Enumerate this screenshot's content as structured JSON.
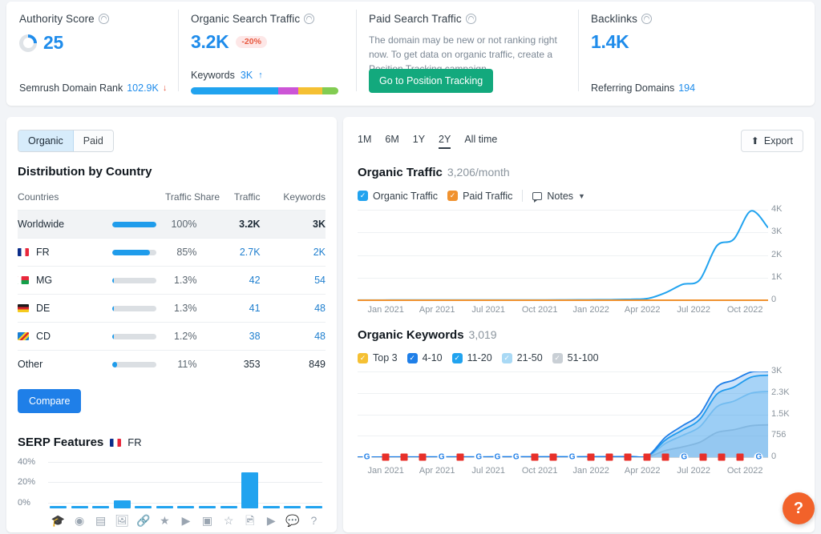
{
  "header": {
    "authority": {
      "label": "Authority Score",
      "value": "25",
      "footnote_label": "Semrush Domain Rank",
      "footnote_value": "102.9K",
      "footnote_trend": "down",
      "donut_percent": 25
    },
    "organic_search": {
      "label": "Organic Search Traffic",
      "value": "3.2K",
      "change": "-20%",
      "change_color": "#e8593f",
      "keywords_label": "Keywords",
      "keywords_value": "3K",
      "keywords_trend": "up",
      "bar_segments": [
        {
          "name": "top3",
          "color": "#21a3ef",
          "pct": 59
        },
        {
          "name": "4-10",
          "color": "#cc55d6",
          "pct": 14
        },
        {
          "name": "11-20",
          "color": "#f5c033",
          "pct": 16
        },
        {
          "name": "21-50",
          "color": "#82cc52",
          "pct": 11
        }
      ]
    },
    "paid_search": {
      "label": "Paid Search Traffic",
      "description": "The domain may be new or not ranking right now. To get data on organic traffic, create a Position Tracking campaign.",
      "button": "Go to Position Tracking",
      "button_color": "#13a97d"
    },
    "backlinks": {
      "label": "Backlinks",
      "value": "1.4K",
      "footnote_label": "Referring Domains",
      "footnote_value": "194"
    }
  },
  "left": {
    "toggle": {
      "organic": "Organic",
      "paid": "Paid",
      "selected": "Organic"
    },
    "distribution_title": "Distribution by Country",
    "columns": [
      "Countries",
      "Traffic Share",
      "Traffic",
      "Keywords"
    ],
    "rows": [
      {
        "country": "Worldwide",
        "flag": null,
        "share_pct": 100,
        "share": "100%",
        "traffic": "3.2K",
        "keywords": "3K",
        "highlight": true
      },
      {
        "country": "FR",
        "flag": "fr",
        "share_pct": 85,
        "share": "85%",
        "traffic": "2.7K",
        "keywords": "2K",
        "highlight": false
      },
      {
        "country": "MG",
        "flag": "mg",
        "share_pct": 3,
        "share": "1.3%",
        "traffic": "42",
        "keywords": "54",
        "highlight": false
      },
      {
        "country": "DE",
        "flag": "de",
        "share_pct": 3,
        "share": "1.3%",
        "traffic": "41",
        "keywords": "48",
        "highlight": false
      },
      {
        "country": "CD",
        "flag": "cd",
        "share_pct": 3,
        "share": "1.2%",
        "traffic": "38",
        "keywords": "48",
        "highlight": false
      },
      {
        "country": "Other",
        "flag": null,
        "share_pct": 11,
        "share": "11%",
        "traffic": "353",
        "keywords": "849",
        "highlight": false
      }
    ],
    "compare_button": "Compare",
    "serp": {
      "title": "SERP Features",
      "country": "FR",
      "country_flag": "fr"
    }
  },
  "right": {
    "ranges": [
      "1M",
      "6M",
      "1Y",
      "2Y",
      "All time"
    ],
    "range_selected": "2Y",
    "export": "Export",
    "traffic": {
      "title": "Organic Traffic",
      "value": "3,206/month",
      "legend": [
        {
          "label": "Organic Traffic",
          "color": "#21a3ef",
          "checked": true
        },
        {
          "label": "Paid Traffic",
          "color": "#f0922f",
          "checked": true
        }
      ],
      "notes": "Notes"
    },
    "keywords": {
      "title": "Organic Keywords",
      "value": "3,019",
      "legend": [
        {
          "label": "Top 3",
          "color": "#f5c033",
          "checked": true
        },
        {
          "label": "4-10",
          "color": "#1f7fe8",
          "checked": true
        },
        {
          "label": "11-20",
          "color": "#21a3ef",
          "checked": true
        },
        {
          "label": "21-50",
          "color": "#a9d9f5",
          "checked": true
        },
        {
          "label": "51-100",
          "color": "#c9cfd5",
          "checked": true
        }
      ]
    }
  },
  "help_button": "?",
  "chart_data": [
    {
      "type": "bar",
      "title": "SERP Features",
      "xlabel": "",
      "ylabel": "",
      "ylim": [
        0,
        40
      ],
      "yticks": [
        "0%",
        "20%",
        "40%"
      ],
      "categories": [
        "featured-snippet",
        "local-pack",
        "reviews",
        "image-pack",
        "sitelinks",
        "featured-review",
        "video",
        "video-carousel",
        "top-stories",
        "images",
        "instant-answer",
        "people-also-ask",
        "faq"
      ],
      "values": [
        0.8,
        0.8,
        0.8,
        8,
        2,
        0.8,
        0.8,
        0.8,
        0.8,
        35,
        0.8,
        0.8,
        0.8
      ],
      "grid": true
    },
    {
      "type": "line",
      "title": "Organic Traffic",
      "subtitle": "3,206/month",
      "xlabel": "",
      "ylabel": "",
      "ylim": [
        0,
        4000
      ],
      "yticks": [
        "0",
        "1K",
        "2K",
        "3K",
        "4K"
      ],
      "xtick_labels": [
        "Jan 2021",
        "Apr 2021",
        "Jul 2021",
        "Oct 2021",
        "Jan 2022",
        "Apr 2022",
        "Jul 2022",
        "Oct 2022"
      ],
      "x": [
        "Nov 2020",
        "Dec 2020",
        "Jan 2021",
        "Feb 2021",
        "Mar 2021",
        "Apr 2021",
        "May 2021",
        "Jun 2021",
        "Jul 2021",
        "Aug 2021",
        "Sep 2021",
        "Oct 2021",
        "Nov 2021",
        "Dec 2021",
        "Jan 2022",
        "Feb 2022",
        "Mar 2022",
        "Apr 2022",
        "May 2022",
        "Jun 2022",
        "Jul 2022",
        "Aug 2022",
        "Sep 2022",
        "Oct 2022",
        "Nov 2022"
      ],
      "series": [
        {
          "name": "Organic Traffic",
          "color": "#21a3ef",
          "values": [
            5,
            5,
            6,
            6,
            7,
            7,
            8,
            8,
            9,
            10,
            10,
            12,
            14,
            16,
            20,
            26,
            40,
            80,
            330,
            700,
            900,
            2400,
            2700,
            3950,
            3206
          ]
        },
        {
          "name": "Paid Traffic",
          "color": "#f0922f",
          "values": [
            0,
            0,
            0,
            0,
            0,
            0,
            0,
            0,
            0,
            0,
            0,
            0,
            0,
            0,
            0,
            0,
            0,
            0,
            0,
            0,
            0,
            0,
            0,
            0,
            0
          ]
        }
      ],
      "grid": true,
      "legend_position": "top"
    },
    {
      "type": "area",
      "title": "Organic Keywords",
      "subtitle": "3,019",
      "xlabel": "",
      "ylabel": "",
      "ylim": [
        0,
        3000
      ],
      "yticks": [
        "0",
        "756",
        "1.5K",
        "2.3K",
        "3K"
      ],
      "xtick_labels": [
        "Jan 2021",
        "Apr 2021",
        "Jul 2021",
        "Oct 2021",
        "Jan 2022",
        "Apr 2022",
        "Jul 2022",
        "Oct 2022"
      ],
      "x": [
        "Nov 2020",
        "Dec 2020",
        "Jan 2021",
        "Feb 2021",
        "Mar 2021",
        "Apr 2021",
        "May 2021",
        "Jun 2021",
        "Jul 2021",
        "Aug 2021",
        "Sep 2021",
        "Oct 2021",
        "Nov 2021",
        "Dec 2021",
        "Jan 2022",
        "Feb 2022",
        "Mar 2022",
        "Apr 2022",
        "May 2022",
        "Jun 2022",
        "Jul 2022",
        "Aug 2022",
        "Sep 2022",
        "Oct 2022",
        "Nov 2022"
      ],
      "series": [
        {
          "name": "Total (4-10)",
          "color": "#1f7fe8",
          "values": [
            4,
            4,
            5,
            5,
            6,
            6,
            7,
            7,
            8,
            8,
            9,
            10,
            11,
            12,
            14,
            16,
            20,
            60,
            700,
            1100,
            1500,
            2450,
            2700,
            2980,
            3019
          ]
        },
        {
          "name": "11-20",
          "color": "#21a3ef",
          "values": [
            3,
            3,
            4,
            4,
            5,
            5,
            5,
            6,
            6,
            6,
            7,
            8,
            9,
            10,
            11,
            13,
            16,
            50,
            600,
            950,
            1320,
            2200,
            2450,
            2800,
            2870
          ]
        },
        {
          "name": "21-50",
          "color": "#a9d9f5",
          "values": [
            2,
            2,
            3,
            3,
            3,
            4,
            4,
            4,
            5,
            5,
            5,
            6,
            7,
            8,
            9,
            10,
            13,
            40,
            480,
            760,
            1060,
            1760,
            1960,
            2240,
            2300
          ]
        },
        {
          "name": "51-100",
          "color": "#c9cfd5",
          "values": [
            1,
            1,
            1,
            1,
            2,
            2,
            2,
            2,
            2,
            3,
            3,
            3,
            4,
            4,
            5,
            5,
            7,
            20,
            230,
            360,
            520,
            860,
            960,
            1100,
            1130
          ]
        }
      ],
      "markers": [
        "G",
        "R",
        "R",
        "R",
        "G",
        "R",
        "G",
        "G",
        "G",
        "R",
        "R",
        "G",
        "R",
        "R",
        "R",
        "R",
        "R",
        "G",
        "R",
        "R",
        "R",
        "G"
      ],
      "grid": true,
      "legend_position": "top"
    }
  ]
}
